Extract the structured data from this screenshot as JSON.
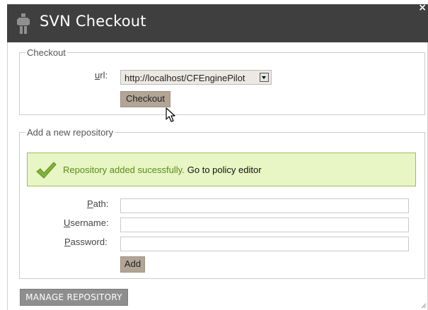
{
  "dialog": {
    "title": "SVN Checkout",
    "close_glyph": "×",
    "title_icon": "robot-icon"
  },
  "checkout": {
    "legend": "Checkout",
    "url_label_underlined": "u",
    "url_label_rest": "rl:",
    "url_selected": "http://localhost/CFEnginePilot",
    "checkout_button": "Checkout"
  },
  "repository": {
    "legend": "Add a new repository",
    "success_message": "Repository added sucessfully.",
    "success_link": "Go to policy editor",
    "path_label_underlined": "P",
    "path_label_rest": "ath:",
    "username_label_underlined": "U",
    "username_label_rest": "sername:",
    "password_label_underlined": "P",
    "password_label_rest": "assword:",
    "path_value": "",
    "username_value": "",
    "password_value": "",
    "add_button": "Add"
  },
  "footer": {
    "manage_button": "MANAGE REPOSITORY"
  },
  "colors": {
    "titlebar": "#3f3f3f",
    "button": "#b2a596",
    "success_bg": "#e8f5c4",
    "success_text": "#5a8b1a",
    "manage_button": "#8e8e8e"
  }
}
